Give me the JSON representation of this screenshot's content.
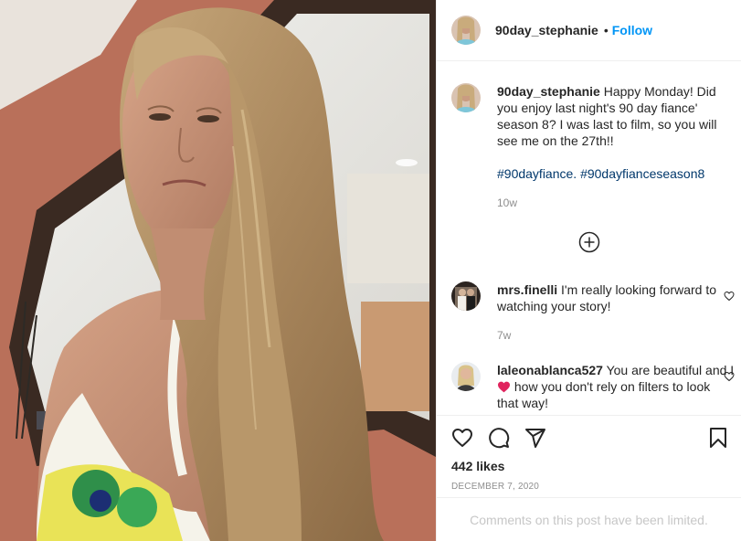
{
  "post": {
    "author": "90day_stephanie",
    "follow_label": "Follow",
    "separator": "•"
  },
  "caption": {
    "username": "90day_stephanie",
    "text": "Happy Monday! Did you enjoy last night's 90 day fiance' season 8? I was last to film, so you will see me on the 27th!!",
    "hashtags": "#90dayfiance. #90dayfianceseason8",
    "time": "10w"
  },
  "comments": [
    {
      "username": "mrs.finelli",
      "text": "I'm really looking forward to watching your story!",
      "time": "7w"
    },
    {
      "username": "laleonablanca527",
      "text_before": "You are beautiful and I",
      "text_after": "how you don't rely on filters to look that way!"
    }
  ],
  "likes": "442 likes",
  "date": "DECEMBER 7, 2020",
  "limited_notice": "Comments on this post have been limited.",
  "icons": {
    "like": "heart-icon",
    "comment": "comment-icon",
    "share": "paper-plane-icon",
    "save": "bookmark-icon",
    "load_more": "plus-circle-icon",
    "emoji": "red-heart-emoji"
  },
  "colors": {
    "link": "#0095f6",
    "hashtag": "#00376b",
    "muted": "#8e8e8e",
    "text": "#262626",
    "limited": "#c7c7c7",
    "emoji_heart": "#e0245e"
  }
}
